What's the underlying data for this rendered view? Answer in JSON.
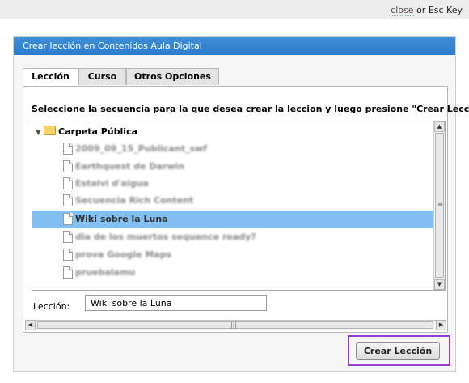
{
  "topbar": {
    "close_label": "close",
    "or_esc_label": " or Esc Key"
  },
  "dialog": {
    "title": "Crear lección en Contenidos Aula Digital",
    "tabs": [
      {
        "label": "Lección",
        "active": true
      },
      {
        "label": "Curso",
        "active": false
      },
      {
        "label": "Otros Opciones",
        "active": false
      }
    ],
    "instruction": "Seleccione la secuencia para la que desea crear la leccion y luego presione \"Crear Lección\"",
    "tree": {
      "root_label": "Carpeta Pública",
      "items": [
        {
          "label": "2009_09_15_Publicant_swf",
          "blurred": true,
          "selected": false
        },
        {
          "label": "Earthquest de Darwin",
          "blurred": true,
          "selected": false
        },
        {
          "label": "Estalvi d'aigua",
          "blurred": true,
          "selected": false
        },
        {
          "label": "Secuencia Rich Content",
          "blurred": true,
          "selected": false
        },
        {
          "label": "Wiki sobre la Luna",
          "blurred": false,
          "selected": true
        },
        {
          "label": "dia de los muertos sequence ready?",
          "blurred": true,
          "selected": false
        },
        {
          "label": "prova Google Maps",
          "blurred": true,
          "selected": false
        },
        {
          "label": "pruebalamu",
          "blurred": true,
          "selected": false
        }
      ]
    },
    "field_label": "Lección:",
    "field_value": "Wiki sobre la Luna",
    "create_button_label": "Crear Lección"
  },
  "colors": {
    "title_bar": "#3a8ad6",
    "selected_row": "#82c0f3",
    "button_outline": "#9c3dd1"
  },
  "icons": {
    "expander": "triangle-down-icon",
    "folder": "folder-icon",
    "document": "document-icon"
  }
}
